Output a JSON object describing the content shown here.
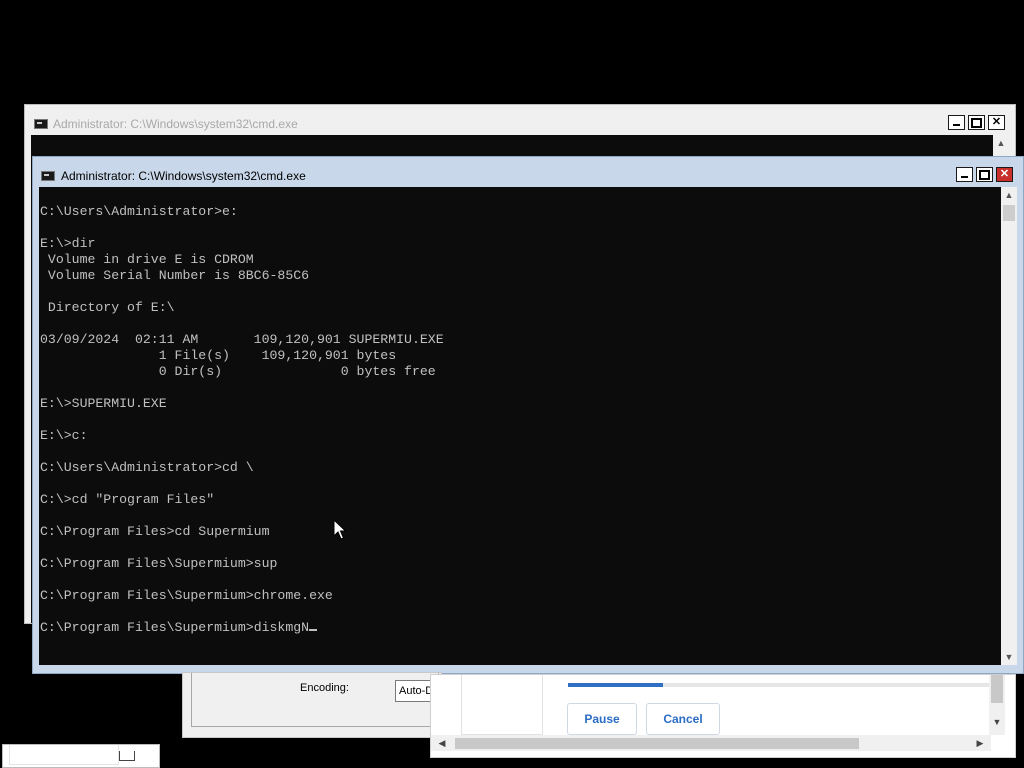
{
  "back_window": {
    "title": "Administrator: C:\\Windows\\system32\\cmd.exe",
    "icon": "cmd-icon",
    "controls": [
      "minimize",
      "maximize",
      "close"
    ]
  },
  "front_window": {
    "title": "Administrator: C:\\Windows\\system32\\cmd.exe",
    "icon": "cmd-icon",
    "controls": [
      "minimize",
      "maximize",
      "close"
    ],
    "console_text": "C:\\Users\\Administrator>e:\n\nE:\\>dir\n Volume in drive E is CDROM\n Volume Serial Number is 8BC6-85C6\n\n Directory of E:\\\n\n03/09/2024  02:11 AM       109,120,901 SUPERMIU.EXE\n               1 File(s)    109,120,901 bytes\n               0 Dir(s)               0 bytes free\n\nE:\\>SUPERMIU.EXE\n\nE:\\>c:\n\nC:\\Users\\Administrator>cd \\\n\nC:\\>cd \"Program Files\"\n\nC:\\Program Files>cd Supermium\n\nC:\\Program Files\\Supermium>sup\n\nC:\\Program Files\\Supermium>chrome.exe\n\nC:\\Program Files\\Supermium>",
    "current_input": "diskmgN"
  },
  "encoding_dialog": {
    "label": "Encoding:",
    "selected": "Auto-D"
  },
  "download_panel": {
    "progress": 0.226,
    "accent": "#2f6fc4",
    "pause_label": "Pause",
    "cancel_label": "Cancel"
  },
  "colors": {
    "console_bg": "#0c0c0c",
    "console_fg": "#c0c0c0",
    "close_red": "#c9302c"
  }
}
